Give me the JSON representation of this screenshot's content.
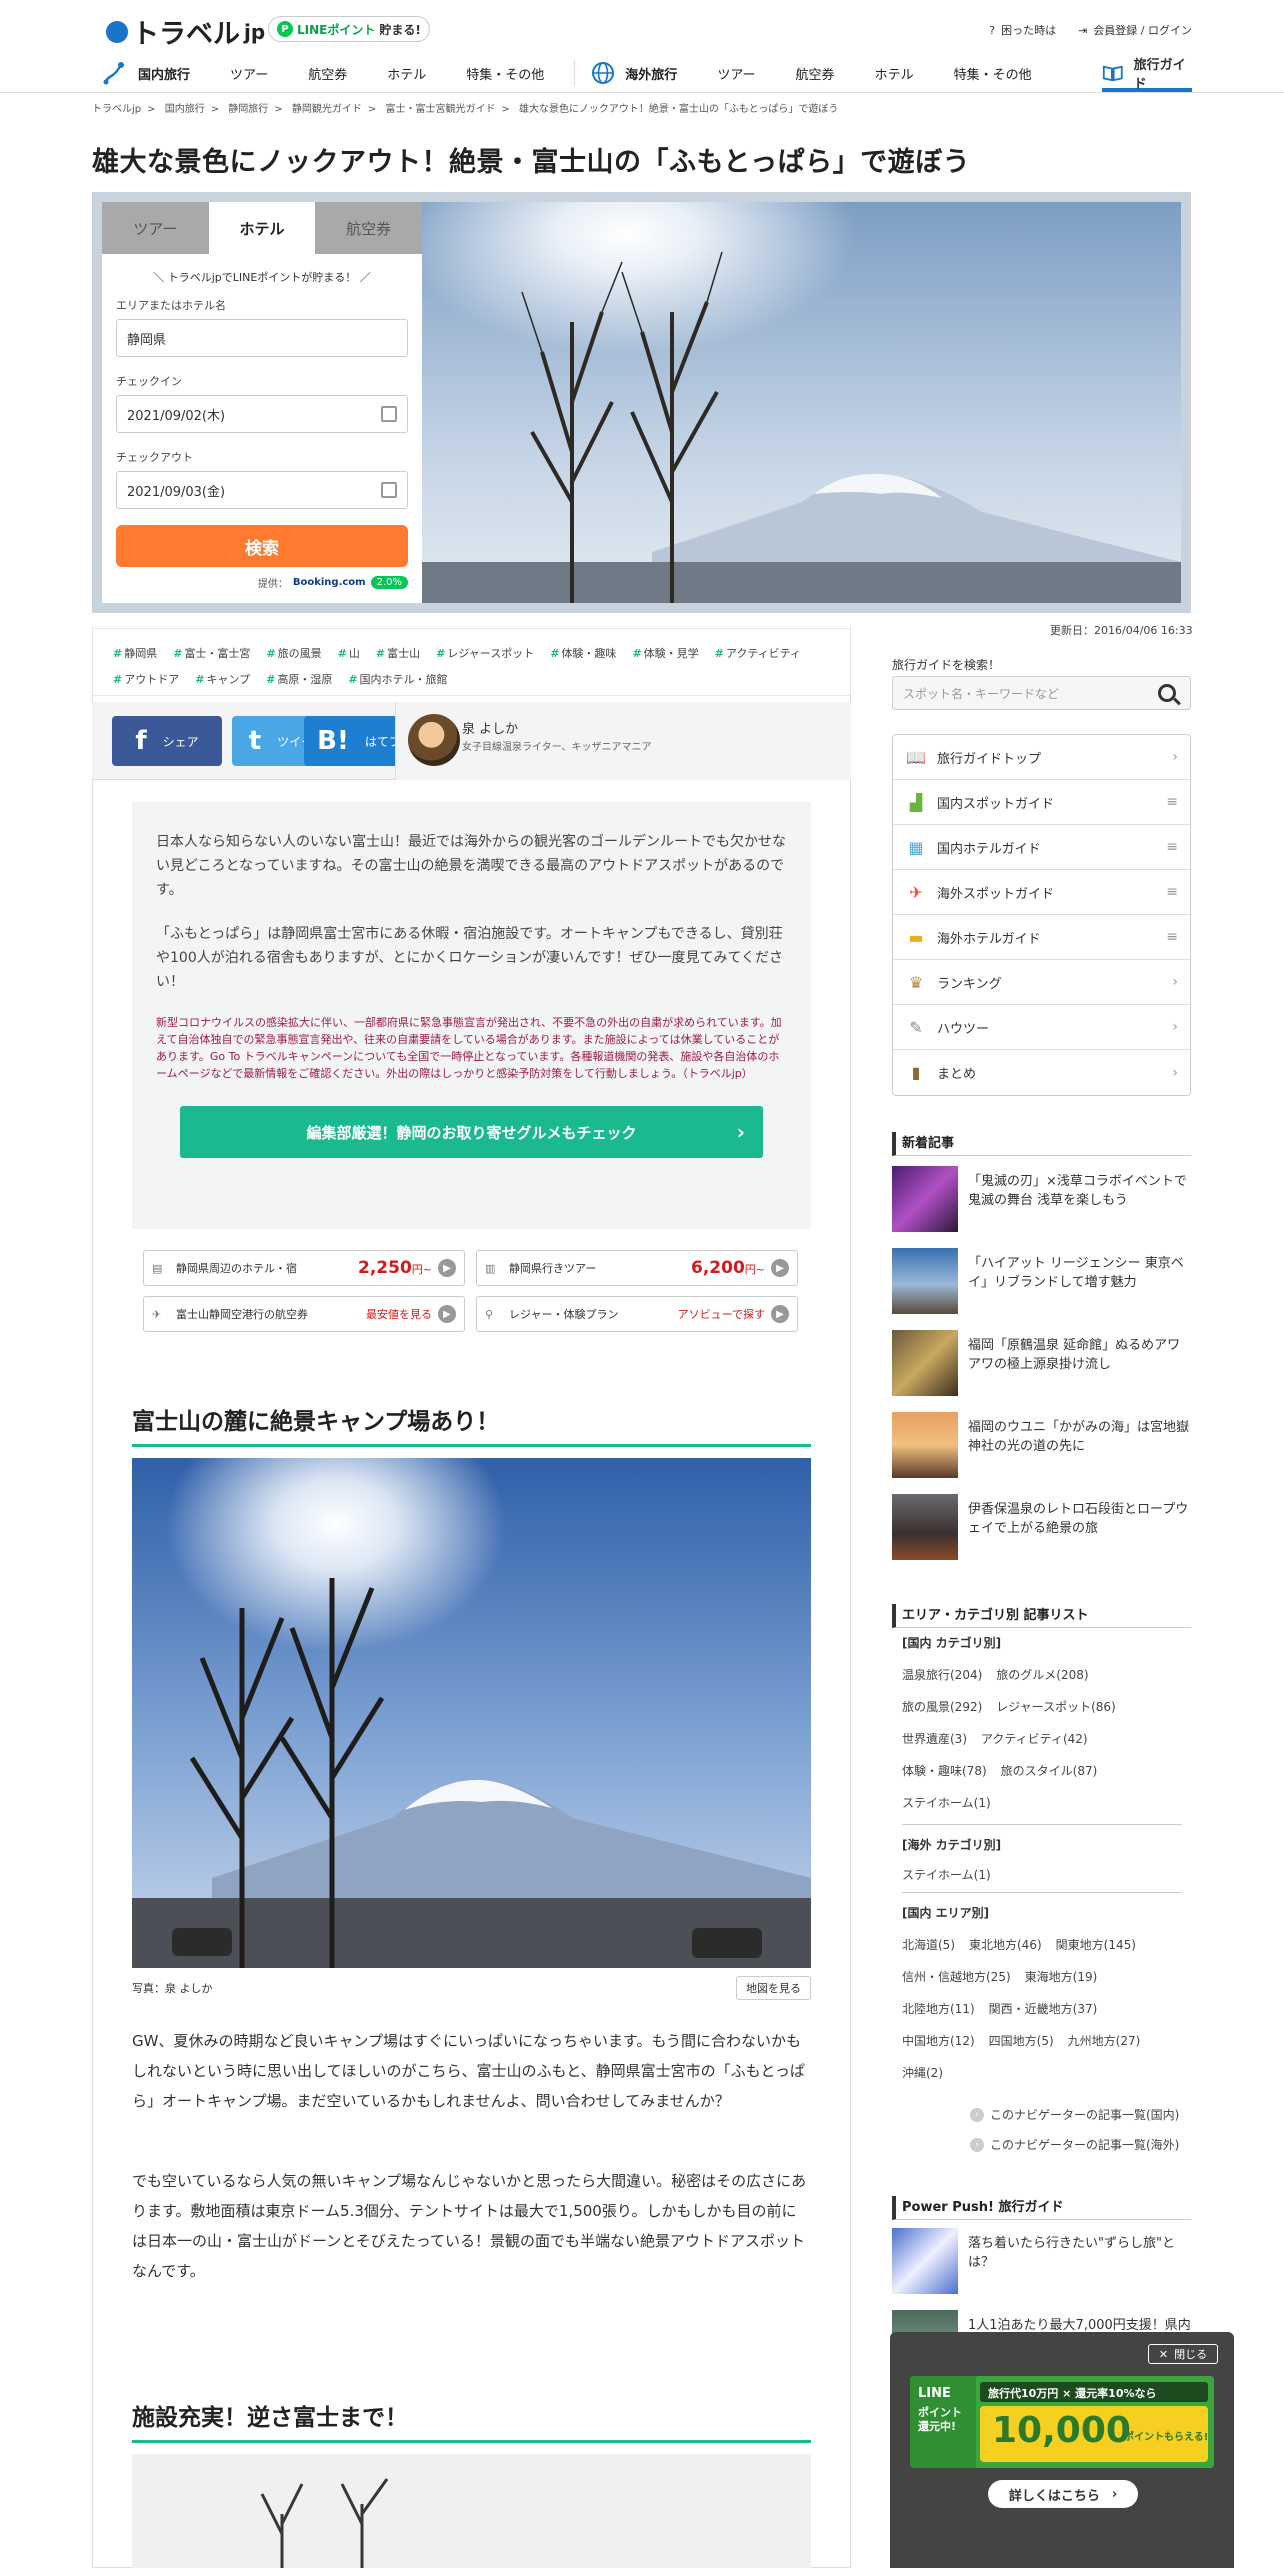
{
  "header": {
    "logo_text": "トラベル",
    "logo_jp": "jp",
    "line_badge_icon": "P",
    "line_badge_brand": "LINEポイント",
    "line_badge_text": "貯まる!",
    "help_label": "困った時は",
    "login_label": "会員登録 / ログイン"
  },
  "nav": {
    "domestic_label": "国内旅行",
    "domestic_items": [
      "ツアー",
      "航空券",
      "ホテル",
      "特集・その他"
    ],
    "overseas_label": "海外旅行",
    "overseas_items": [
      "ツアー",
      "航空券",
      "ホテル",
      "特集・その他"
    ],
    "guide_label": "旅行ガイド"
  },
  "breadcrumb": [
    "トラベルjp",
    "国内旅行",
    "静岡旅行",
    "静岡観光ガイド",
    "富士・富士宮観光ガイド",
    "雄大な景色にノックアウト！絶景・富士山の「ふもとっぱら」で遊ぼう"
  ],
  "breadcrumb_sep": ">",
  "page_title": "雄大な景色にノックアウト！絶景・富士山の「ふもとっぱら」で遊ぼう",
  "search": {
    "tabs": [
      "ツアー",
      "ホテル",
      "航空券"
    ],
    "promo": "＼ トラベルjpでLINEポイントが貯まる！ ／",
    "area_label": "エリアまたはホテル名",
    "area_value": "静岡県",
    "checkin_label": "チェックイン",
    "checkin_value": "2021/09/02(木)",
    "checkout_label": "チェックアウト",
    "checkout_value": "2021/09/03(金)",
    "button_label": "検索",
    "powered_prefix": "提供：",
    "powered_brand": "Booking.com",
    "powered_pct": "2.0%"
  },
  "updated": "更新日：2016/04/06 16:33",
  "tags": [
    "静岡県",
    "富士・富士宮",
    "旅の風景",
    "山",
    "富士山",
    "レジャースポット",
    "体験・趣味",
    "体験・見学",
    "アクティビティ",
    "アウトドア",
    "キャンプ",
    "高原・湿原",
    "国内ホテル・旅館"
  ],
  "tag_mark": "#",
  "share": {
    "facebook_icon": "f",
    "facebook": "シェア",
    "twitter_icon": "t",
    "twitter": "ツイート",
    "hatena_icon": "B!",
    "hatena": "はてブ"
  },
  "author": {
    "name": "泉 よしか",
    "role": "女子目線温泉ライター、キッザニアマニア"
  },
  "intro": {
    "p1": "日本人なら知らない人のいない富士山！最近では海外からの観光客のゴールデンルートでも欠かせない見どころとなっていますね。その富士山の絶景を満喫できる最高のアウトドアスポットがあるのです。",
    "p2": "「ふもとっぱら」は静岡県富士宮市にある休暇・宿泊施設です。オートキャンプもできるし、貸別荘や100人が泊れる宿舎もありますが、とにかくロケーションが凄いんです！ぜひ一度見てみてください！",
    "warning": "新型コロナウイルスの感染拡大に伴い、一部都府県に緊急事態宣言が発出され、不要不急の外出の自粛が求められています。加えて自治体独自での緊急事態宣言発出や、往来の自粛要請をしている場合があります。また施設によっては休業していることがあります。Go To トラベルキャンペーンについても全国で一時停止となっています。各種報道機関の発表、施設や各自治体のホームページなどで最新情報をご確認ください。外出の際はしっかりと感染予防対策をして行動しましょう。（トラベルjp）",
    "gourmet_button": "編集部厳選！静岡のお取り寄せグルメもチェック"
  },
  "quicklinks": [
    {
      "label": "静岡県周辺のホテル・宿",
      "price": "2,250",
      "suffix": "円~"
    },
    {
      "label": "静岡県行きツアー",
      "price": "6,200",
      "suffix": "円~"
    },
    {
      "label": "富士山静岡空港行の航空券",
      "price": "最安値を見る",
      "suffix": ""
    },
    {
      "label": "レジャー・体験プラン",
      "price": "アソビューで探す",
      "suffix": ""
    }
  ],
  "section1": {
    "heading": "富士山の麓に絶景キャンプ場あり！",
    "caption": "写真：泉 よしか",
    "map_button": "地図を見る",
    "p1": "GW、夏休みの時期など良いキャンプ場はすぐにいっぱいになっちゃいます。もう間に合わないかもしれないという時に思い出してほしいのがこちら、富士山のふもと、静岡県富士宮市の「ふもとっぱら」オートキャンプ場。まだ空いているかもしれませんよ、問い合わせしてみませんか？",
    "p2": "でも空いているなら人気の無いキャンプ場なんじゃないかと思ったら大間違い。秘密はその広さにあります。敷地面積は東京ドーム5.3個分、テントサイトは最大で1,500張り。しかもしかも目の前には日本一の山・富士山がドーンとそびえたっている！景観の面でも半端ない絶景アウトドアスポットなんです。"
  },
  "section2": {
    "heading": "施設充実！逆さ富士まで！"
  },
  "sidebar": {
    "search_label": "旅行ガイドを検索！",
    "search_placeholder": "スポット名・キーワードなど",
    "menu": [
      {
        "label": "旅行ガイドトップ",
        "arrow": "›"
      },
      {
        "label": "国内スポットガイド",
        "arrow": "≡"
      },
      {
        "label": "国内ホテルガイド",
        "arrow": "≡"
      },
      {
        "label": "海外スポットガイド",
        "arrow": "≡"
      },
      {
        "label": "海外ホテルガイド",
        "arrow": "≡"
      },
      {
        "label": "ランキング",
        "arrow": "›"
      },
      {
        "label": "ハウツー",
        "arrow": "›"
      },
      {
        "label": "まとめ",
        "arrow": "›"
      }
    ],
    "new_heading": "新着記事",
    "new_articles": [
      "「鬼滅の刃」×浅草コラボイベントで鬼滅の舞台 浅草を楽しもう",
      "「ハイアット リージェンシー 東京ベイ」リブランドして増す魅力",
      "福岡「原鶴温泉 延命館」ぬるめアワアワの極上源泉掛け流し",
      "福岡のウユニ「かがみの海」は宮地嶽神社の光の道の先に",
      "伊香保温泉のレトロ石段街とロープウェイで上がる絶景の旅"
    ],
    "cat_heading": "エリア・カテゴリ別 記事リスト",
    "dom_cat_heading": "[国内 カテゴリ別]",
    "dom_cats": [
      [
        "温泉旅行(204)",
        "旅のグルメ(208)"
      ],
      [
        "旅の風景(292)",
        "レジャースポット(86)"
      ],
      [
        "世界遺産(3)",
        "アクティビティ(42)"
      ],
      [
        "体験・趣味(78)",
        "旅のスタイル(87)"
      ],
      [
        "ステイホーム(1)"
      ]
    ],
    "ovs_cat_heading": "[海外 カテゴリ別]",
    "ovs_cats": [
      [
        "ステイホーム(1)"
      ]
    ],
    "dom_area_heading": "[国内 エリア別]",
    "dom_areas": [
      [
        "北海道(5)",
        "東北地方(46)",
        "関東地方(145)"
      ],
      [
        "信州・信越地方(25)",
        "東海地方(19)"
      ],
      [
        "北陸地方(11)",
        "関西・近畿地方(37)"
      ],
      [
        "中国地方(12)",
        "四国地方(5)",
        "九州地方(27)"
      ],
      [
        "沖縄(2)"
      ]
    ],
    "navlink_icon": "›",
    "navlinks": [
      "このナビゲーターの記事一覧(国内)",
      "このナビゲーターの記事一覧(海外)"
    ],
    "push_heading": "Power Push! 旅行ガイド",
    "push_articles": [
      "落ち着いたら行きたい\"ずらし旅\"とは？",
      "1人1泊あたり最大7,000円支援！県内旅行をお得に楽しもう"
    ]
  },
  "popup": {
    "close_label": "閉じる",
    "ad_line_label": "LINE",
    "ad_sub": "ポイント還元中!",
    "ad_top": "旅行代10万円 × 還元率10%なら",
    "ad_big": "10,000",
    "ad_unit": "ポイントもらえる!",
    "detail_button": "詳しくはこちら"
  },
  "colors": {
    "accent": "#1bb98f",
    "search_button": "#ff7a2f",
    "brand_blue": "#1a74c9",
    "price_red": "#d51a1a"
  }
}
